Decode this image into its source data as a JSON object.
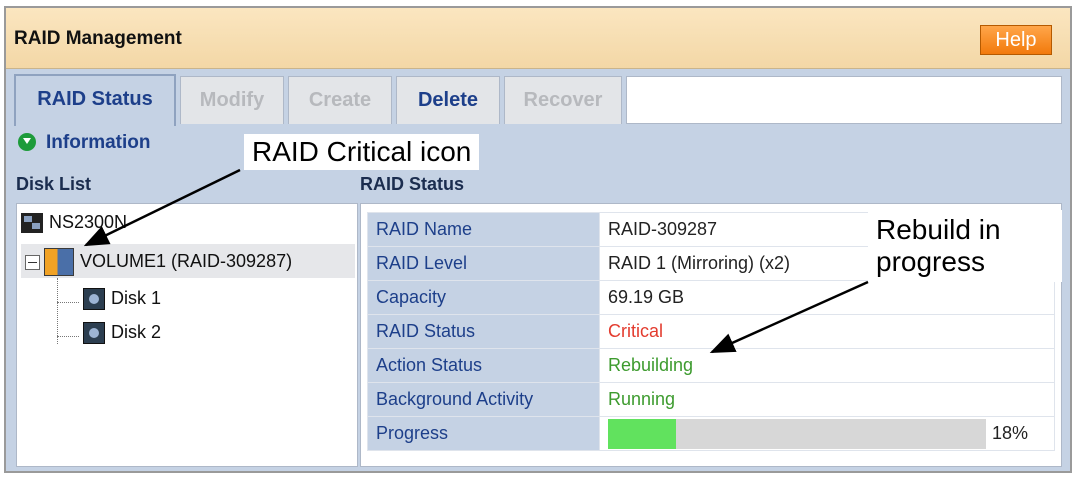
{
  "header": {
    "title": "RAID Management",
    "help_label": "Help"
  },
  "tabs": [
    {
      "label": "RAID Status"
    },
    {
      "label": "Modify"
    },
    {
      "label": "Create"
    },
    {
      "label": "Delete"
    },
    {
      "label": "Recover"
    }
  ],
  "info": {
    "label": "Information"
  },
  "disk_list": {
    "header": "Disk List",
    "root": "NS2300N",
    "volume": "VOLUME1 (RAID-309287)",
    "disks": [
      "Disk 1",
      "Disk 2"
    ]
  },
  "raid_status": {
    "header": "RAID Status",
    "rows": [
      {
        "label": "RAID Name",
        "value": "RAID-309287"
      },
      {
        "label": "RAID Level",
        "value": "RAID 1 (Mirroring) (x2)"
      },
      {
        "label": "Capacity",
        "value": "69.19 GB"
      },
      {
        "label": "RAID Status",
        "value": "Critical"
      },
      {
        "label": "Action Status",
        "value": "Rebuilding"
      },
      {
        "label": "Background Activity",
        "value": "Running"
      },
      {
        "label": "Progress",
        "value": "18%"
      }
    ],
    "progress_fraction": 0.18
  },
  "annotations": {
    "critical_icon": "RAID Critical icon",
    "rebuild": "Rebuild in progress"
  },
  "colors": {
    "critical": "#e33b2e",
    "ok": "#3d9b2e",
    "progress": "#61e25e",
    "accent": "#1d3f8a",
    "help": "#f27a0c"
  }
}
